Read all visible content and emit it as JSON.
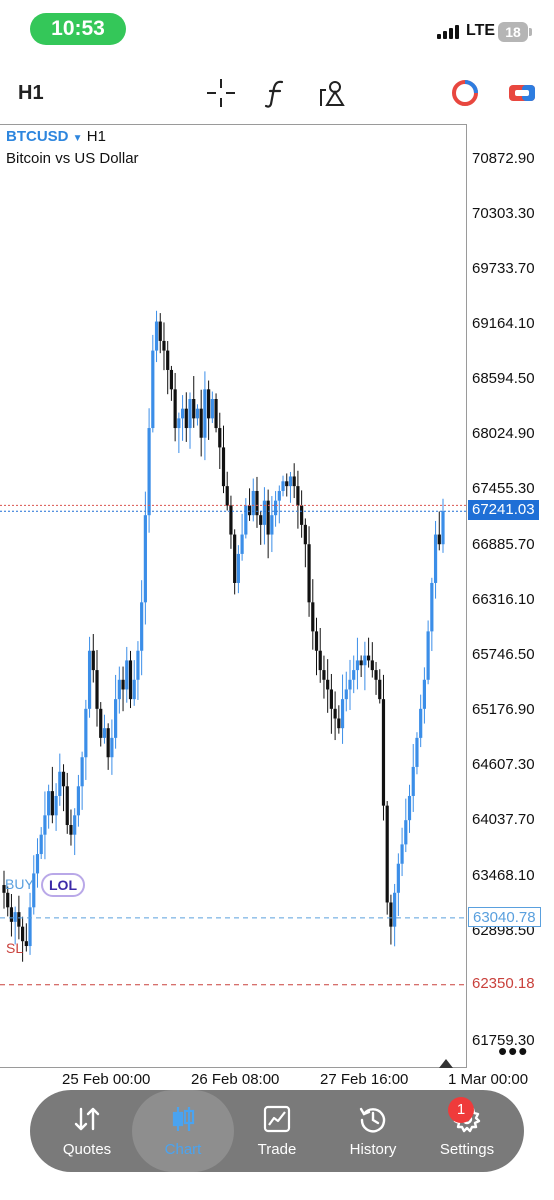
{
  "status_bar": {
    "time": "10:53",
    "network": "LTE",
    "battery": "18"
  },
  "toolbar": {
    "timeframe": "H1"
  },
  "chart": {
    "symbol": "BTCUSD",
    "symbol_timeframe": "H1",
    "description": "Bitcoin vs US Dollar",
    "buy_label": "BUY",
    "lol_badge": "LOL",
    "sl_label": "SL",
    "current_price": "67241.03",
    "buy_price": "63040.78",
    "sl_price": "62350.18",
    "y_axis_labels": [
      "70872.90",
      "70303.30",
      "69733.70",
      "69164.10",
      "68594.50",
      "68024.90",
      "67455.30",
      "66885.70",
      "66316.10",
      "65746.50",
      "65176.90",
      "64607.30",
      "64037.70",
      "63468.10",
      "62898.50",
      "61759.30"
    ],
    "x_axis_labels": [
      "25 Feb 00:00",
      "26 Feb 08:00",
      "27 Feb 16:00",
      "1 Mar 00:00"
    ]
  },
  "chart_data": {
    "type": "candlestick",
    "symbol": "BTCUSD",
    "timeframe": "H1",
    "ylim": [
      61480,
      71230
    ],
    "candles_close": [
      63300,
      63150,
      63000,
      63100,
      62950,
      62800,
      62750,
      63150,
      63500,
      63700,
      63900,
      64100,
      64350,
      64100,
      64300,
      64550,
      64400,
      64000,
      63900,
      64100,
      64400,
      64700,
      65200,
      65800,
      65600,
      65200,
      64900,
      65000,
      64700,
      64900,
      65300,
      65500,
      65400,
      65700,
      65300,
      65500,
      65800,
      66300,
      67200,
      68100,
      68900,
      69200,
      69000,
      68900,
      68700,
      68500,
      68100,
      68200,
      68300,
      68100,
      68400,
      68200,
      68300,
      68000,
      68500,
      68200,
      68400,
      68100,
      67900,
      67500,
      67300,
      67000,
      66500,
      66800,
      67000,
      67300,
      67200,
      67450,
      67200,
      67100,
      67350,
      67000,
      67200,
      67350,
      67450,
      67550,
      67500,
      67600,
      67500,
      67300,
      67100,
      66900,
      66300,
      66000,
      65800,
      65600,
      65500,
      65400,
      65200,
      65100,
      65000,
      65300,
      65400,
      65500,
      65600,
      65700,
      65650,
      65750,
      65700,
      65600,
      65500,
      65300,
      64200,
      63200,
      62950,
      63300,
      63600,
      63800,
      64050,
      64300,
      64600,
      64900,
      65200,
      65500,
      66000,
      66500,
      67000,
      66900,
      67241
    ]
  },
  "tabbar": {
    "items": [
      {
        "label": "Quotes"
      },
      {
        "label": "Chart"
      },
      {
        "label": "Trade"
      },
      {
        "label": "History"
      },
      {
        "label": "Settings"
      }
    ],
    "settings_badge": "1"
  },
  "colors": {
    "bull": "#3b8ee8",
    "bear": "#111111",
    "buy_line": "#5aa0de",
    "sl_line": "#c9413c",
    "ask_line": "#d9534f",
    "price_tag": "#1f6fd6",
    "active_tab": "#4aa3f0"
  }
}
